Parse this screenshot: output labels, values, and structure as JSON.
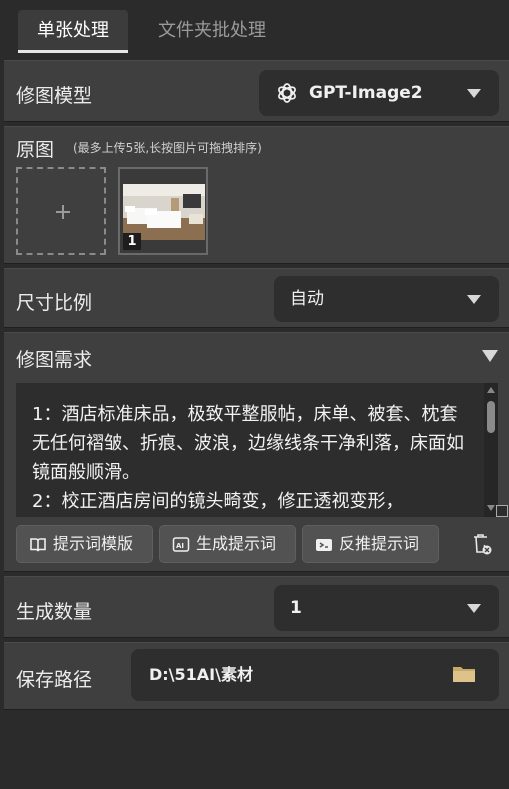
{
  "tabs": [
    {
      "label": "单张处理",
      "active": true
    },
    {
      "label": "文件夹批处理",
      "active": false
    }
  ],
  "model": {
    "label": "修图模型",
    "selected": "GPT-Image2",
    "icon": "openai-logo-icon"
  },
  "original": {
    "label": "原图",
    "hint": "(最多上传5张,长按图片可拖拽排序)",
    "images": [
      {
        "index": "1"
      }
    ]
  },
  "ratio": {
    "label": "尺寸比例",
    "selected": "自动"
  },
  "requirements": {
    "label": "修图需求",
    "text": "1：酒店标准床品，极致平整服帖，床单、被套、枕套无任何褶皱、折痕、波浪，边缘线条干净利落，床面如镜面般顺滑。\n2：校正酒店房间的镜头畸变，修正透视变形，",
    "buttons": {
      "template": "提示词模版",
      "generate": "生成提示词",
      "reverse": "反推提示词"
    }
  },
  "count": {
    "label": "生成数量",
    "selected": "1"
  },
  "save_path": {
    "label": "保存路径",
    "value": "D:\\51AI\\素材"
  },
  "colors": {
    "background": "#2b2b2b",
    "panel": "#3f3f3f",
    "field": "#2e2e2e",
    "button": "#525252",
    "folder": "#c8a96a"
  }
}
